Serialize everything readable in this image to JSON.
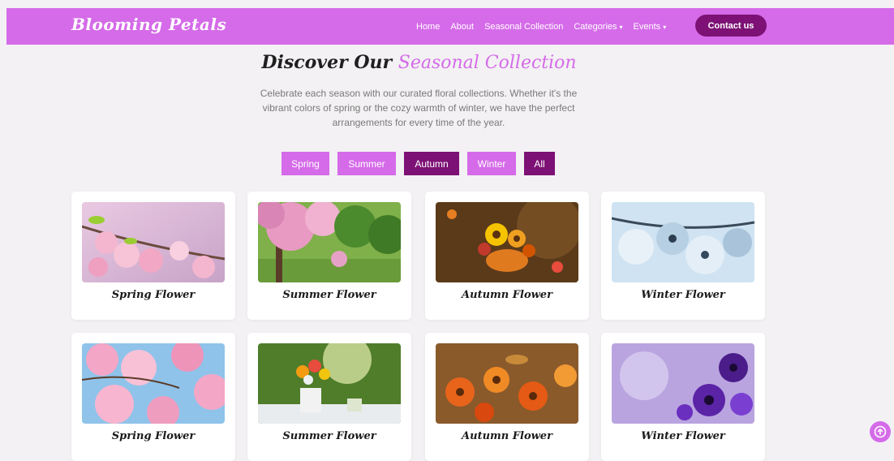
{
  "brand": "Blooming Petals",
  "nav": {
    "home": "Home",
    "about": "About",
    "seasonal": "Seasonal Collection",
    "categories": "Categories",
    "events": "Events",
    "contact": "Contact us",
    "caret": "▾"
  },
  "heading": {
    "prefix": "Discover Our",
    "accent": "Seasonal Collection"
  },
  "intro": "Celebrate each season with our curated floral collections. Whether it's the vibrant colors of spring or the cozy warmth of winter, we have the perfect arrangements for every time of the year.",
  "filters": [
    {
      "label": "Spring",
      "active": false
    },
    {
      "label": "Summer",
      "active": false
    },
    {
      "label": "Autumn",
      "active": true
    },
    {
      "label": "Winter",
      "active": false
    },
    {
      "label": "All",
      "active": true
    }
  ],
  "cards_row1": [
    {
      "title": "Spring Flower"
    },
    {
      "title": "Summer Flower"
    },
    {
      "title": "Autumn Flower"
    },
    {
      "title": "Winter Flower"
    }
  ],
  "cards_row2": [
    {
      "title": "Spring Flower"
    },
    {
      "title": "Summer Flower"
    },
    {
      "title": "Autumn Flower"
    },
    {
      "title": "Winter Flower"
    }
  ],
  "colors": {
    "primary": "#d56be9",
    "dark": "#7d1175",
    "background": "#f3f1f3"
  },
  "icons": {
    "scroll_top": "arrow-up-circle-icon"
  }
}
